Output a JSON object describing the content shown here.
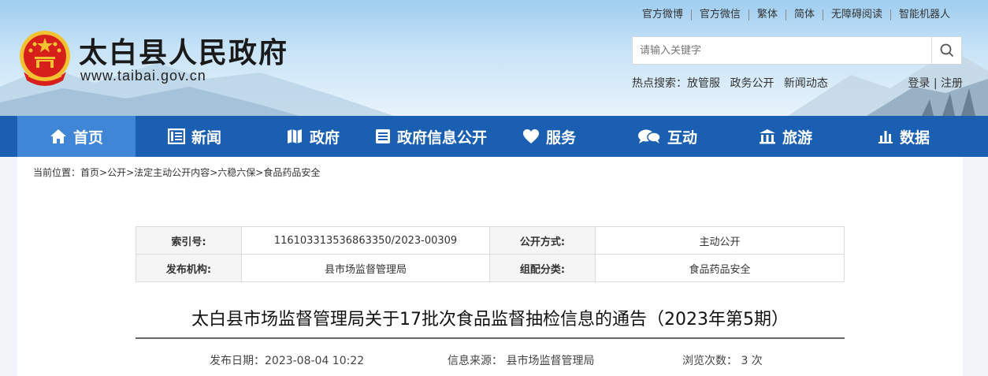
{
  "header": {
    "site_title": "太白县人民政府",
    "site_url": "www.taibai.gov.cn",
    "top_links": [
      "官方微博",
      "官方微信",
      "繁体",
      "简体",
      "无障碍阅读",
      "智能机器人"
    ],
    "search_placeholder": "请输入关键字",
    "hot_label": "热点搜索：",
    "hot_keywords": [
      "放管服",
      "政务公开",
      "新闻动态"
    ],
    "login": "登录",
    "login_sep": "|",
    "register": "注册"
  },
  "nav": {
    "items": [
      {
        "label": "首页",
        "icon": "home-icon"
      },
      {
        "label": "新闻",
        "icon": "news-icon"
      },
      {
        "label": "政府",
        "icon": "map-icon"
      },
      {
        "label": "政府信息公开",
        "icon": "document-list-icon"
      },
      {
        "label": "服务",
        "icon": "heart-icon"
      },
      {
        "label": "互动",
        "icon": "chat-bubbles-icon"
      },
      {
        "label": "旅游",
        "icon": "building-icon"
      },
      {
        "label": "数据",
        "icon": "bar-chart-icon"
      }
    ],
    "active_index": 0
  },
  "breadcrumb": {
    "prefix": "当前位置：",
    "items": [
      "首页",
      "公开",
      "法定主动公开内容",
      "六稳六保",
      "食品药品安全"
    ],
    "separator": ">"
  },
  "meta_table": {
    "index_label": "索引号:",
    "index_value": "116103313536863350/2023-00309",
    "open_mode_label": "公开方式:",
    "open_mode_value": "主动公开",
    "publisher_label": "发布机构:",
    "publisher_value": "县市场监督管理局",
    "category_label": "组配分类:",
    "category_value": "食品药品安全"
  },
  "article": {
    "title": "太白县市场监督管理局关于17批次食品监督抽检信息的通告（2023年第5期）",
    "publish_date": "发布日期：2023-08-04 10:22",
    "source": "信息来源：  县市场监督管理局",
    "views": "浏览次数：  3 次"
  },
  "colors": {
    "nav_bg": "#1b5fb2",
    "nav_active": "#3f87d6",
    "emblem_red": "#d7201c",
    "emblem_gold": "#f2c230"
  }
}
